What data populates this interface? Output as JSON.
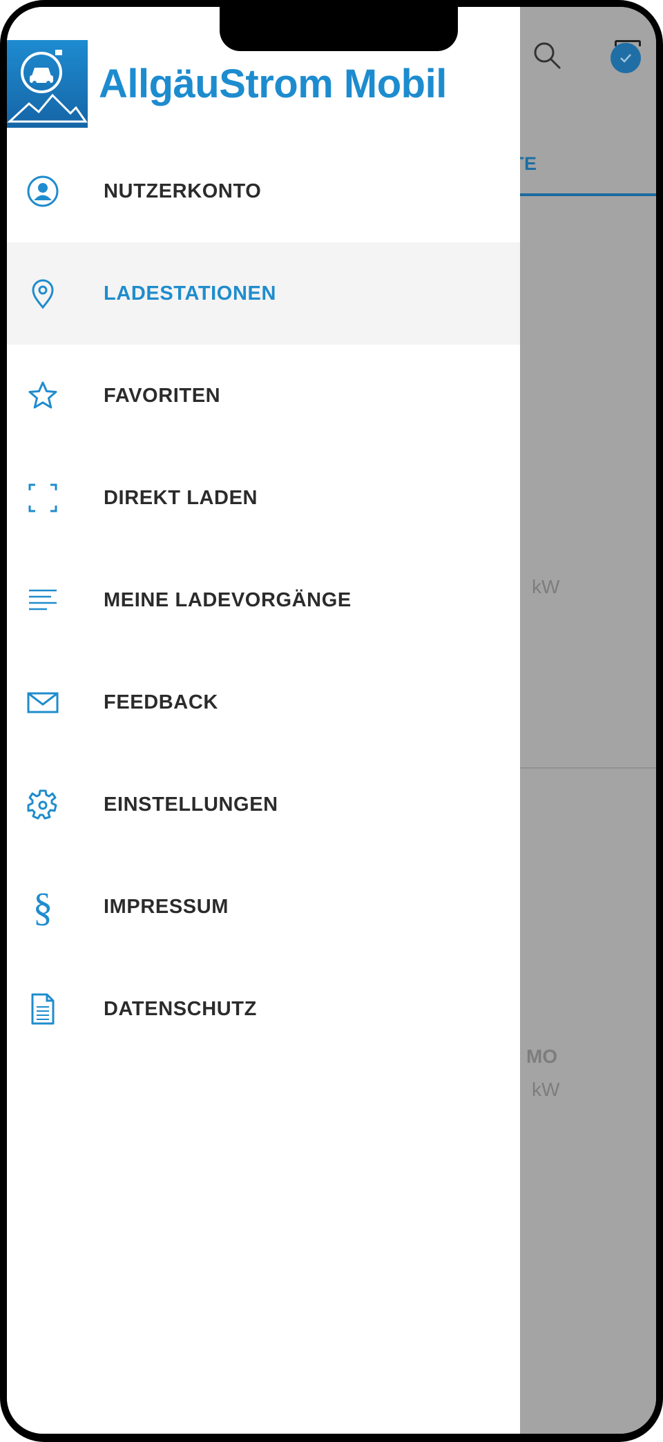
{
  "app": {
    "title": "AllgäuStrom Mobil"
  },
  "colors": {
    "accent": "#1f8ccd",
    "text": "#2b2b2b",
    "active_bg": "#f4f4f4"
  },
  "menu": {
    "items": [
      {
        "label": "NUTZERKONTO",
        "icon": "user-icon",
        "active": false
      },
      {
        "label": "LADESTATIONEN",
        "icon": "location-pin-icon",
        "active": true
      },
      {
        "label": "FAVORITEN",
        "icon": "star-icon",
        "active": false
      },
      {
        "label": "DIREKT LADEN",
        "icon": "scan-frame-icon",
        "active": false
      },
      {
        "label": "MEINE LADEVORGÄNGE",
        "icon": "list-icon",
        "active": false
      },
      {
        "label": "FEEDBACK",
        "icon": "mail-icon",
        "active": false
      },
      {
        "label": "EINSTELLUNGEN",
        "icon": "gear-icon",
        "active": false
      },
      {
        "label": "IMPRESSUM",
        "icon": "section-sign-icon",
        "active": false
      },
      {
        "label": "DATENSCHUTZ",
        "icon": "document-icon",
        "active": false
      }
    ]
  },
  "background": {
    "tab_fragment": "TE",
    "power_unit_1": "kW",
    "station_fragment": "MO",
    "power_unit_2": "kW"
  }
}
